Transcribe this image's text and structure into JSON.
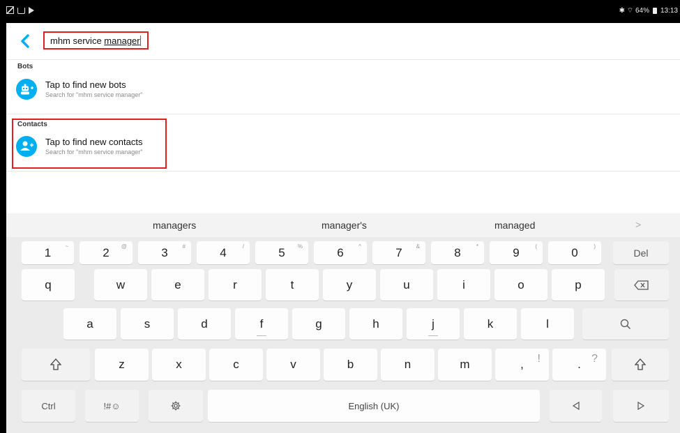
{
  "status_bar": {
    "right_text": "✱ ⌔ 64%",
    "time": "13:13"
  },
  "search": {
    "query_prefix": "mhm service ",
    "query_word": "manager"
  },
  "sections": {
    "bots": {
      "label": "Bots",
      "title": "Tap to find new bots",
      "subtitle": "Search for \"mhm service manager\""
    },
    "contacts": {
      "label": "Contacts",
      "title": "Tap to find new contacts",
      "subtitle": "Search for \"mhm service manager\""
    }
  },
  "keyboard": {
    "suggestions": [
      "managers",
      "manager's",
      "managed"
    ],
    "suggest_more": ">",
    "row1": [
      {
        "k": "1",
        "s": "~"
      },
      {
        "k": "2",
        "s": "@"
      },
      {
        "k": "3",
        "s": "#"
      },
      {
        "k": "4",
        "s": "/"
      },
      {
        "k": "5",
        "s": "%"
      },
      {
        "k": "6",
        "s": "^"
      },
      {
        "k": "7",
        "s": "&"
      },
      {
        "k": "8",
        "s": "*"
      },
      {
        "k": "9",
        "s": "("
      },
      {
        "k": "0",
        "s": ")"
      }
    ],
    "del_label": "Del",
    "row2": [
      "q",
      "w",
      "e",
      "r",
      "t",
      "y",
      "u",
      "i",
      "o",
      "p"
    ],
    "row3": [
      "a",
      "s",
      "d",
      "f",
      "g",
      "h",
      "j",
      "k",
      "l"
    ],
    "row4": [
      "z",
      "x",
      "c",
      "v",
      "b",
      "n",
      "m"
    ],
    "comma": ",",
    "comma_sup": "!",
    "period": ".",
    "period_sup": "?",
    "ctrl_label": "Ctrl",
    "symbols_label": "!#☺",
    "space_label": "English (UK)",
    "icons": {
      "back": "chevron-left-icon",
      "bot": "bot-add-icon",
      "contact": "person-add-icon",
      "backspace": "backspace-icon",
      "search": "search-icon",
      "shift": "shift-icon",
      "settings": "gear-icon",
      "left": "arrow-left-icon",
      "right": "arrow-right-icon"
    },
    "accent_color": "#00aff0",
    "highlight_color": "#e02020"
  }
}
